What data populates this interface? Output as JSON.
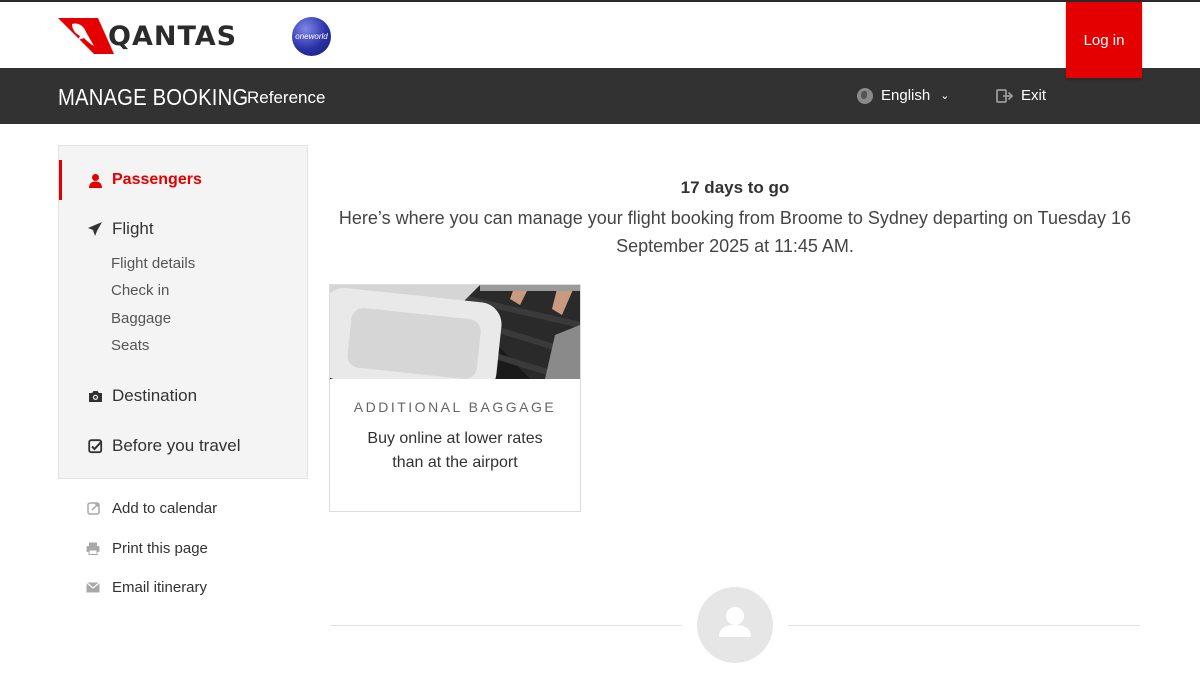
{
  "header": {
    "brand": "QANTAS",
    "alliance": "oneworld",
    "login_label": "Log in",
    "colors": {
      "brand_red": "#e40000",
      "nav_dark": "#323232"
    }
  },
  "nav": {
    "title": "MANAGE BOOKING",
    "reference_label": "Reference",
    "language_label": "English",
    "exit_label": "Exit"
  },
  "sidebar": {
    "items": [
      {
        "label": "Passengers",
        "icon": "person-icon",
        "active": true
      },
      {
        "label": "Flight",
        "icon": "plane-icon"
      },
      {
        "label": "Destination",
        "icon": "camera-icon"
      },
      {
        "label": "Before you travel",
        "icon": "checkbox-icon"
      }
    ],
    "flight_subitems": [
      "Flight details",
      "Check in",
      "Baggage",
      "Seats"
    ],
    "utilities": [
      {
        "label": "Add to calendar",
        "icon": "calendar-icon"
      },
      {
        "label": "Print this page",
        "icon": "printer-icon"
      },
      {
        "label": "Email itinerary",
        "icon": "envelope-icon"
      }
    ]
  },
  "main": {
    "countdown": "17 days to go",
    "description": "Here’s where you can manage your flight booking from Broome to Sydney departing on Tuesday 16 September 2025 at 11:45 AM.",
    "card": {
      "eyebrow": "ADDITIONAL BAGGAGE",
      "text": "Buy online at lower rates than at the airport"
    }
  }
}
